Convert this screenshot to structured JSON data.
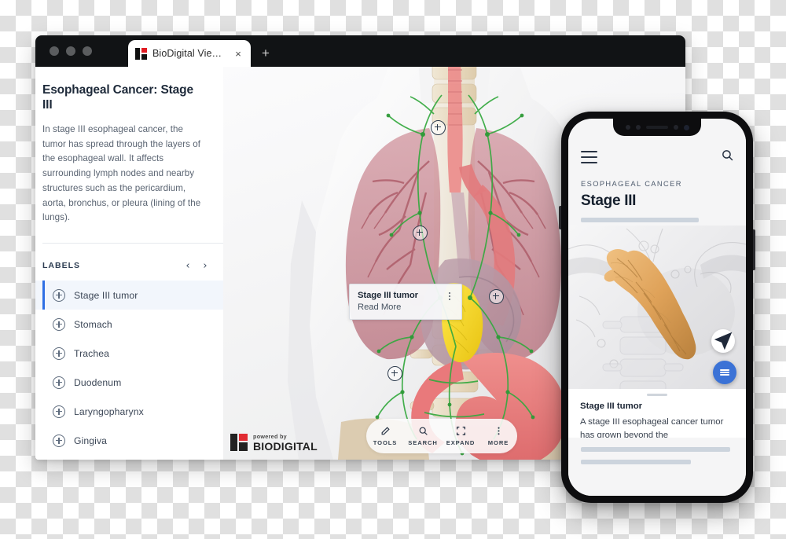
{
  "browser": {
    "tab": {
      "title": "BioDigital Viewer",
      "close_label": "×",
      "favicon": "biodigital-logo-icon"
    },
    "new_tab_label": "+",
    "traffic_lights": 3
  },
  "sidebar": {
    "title": "Esophageal Cancer: Stage III",
    "description": "In stage III esophageal cancer, the tumor has spread through the layers of the esophageal wall. It affects surrounding lymph nodes and nearby structures such as the pericardium, aorta, bronchus, or pleura (lining of the lungs).",
    "labels_header": "LABELS",
    "prev_label": "‹",
    "next_label": "›",
    "items": [
      {
        "label": "Stage III tumor",
        "selected": true
      },
      {
        "label": "Stomach",
        "selected": false
      },
      {
        "label": "Trachea",
        "selected": false
      },
      {
        "label": "Duodenum",
        "selected": false
      },
      {
        "label": "Laryngopharynx",
        "selected": false
      },
      {
        "label": "Gingiva",
        "selected": false
      }
    ]
  },
  "viewer": {
    "tooltip": {
      "title": "Stage III tumor",
      "action": "Read More",
      "menu": "kebab-menu-icon"
    },
    "toolbar": [
      {
        "label": "TOOLS",
        "icon": "pencil-icon"
      },
      {
        "label": "SEARCH",
        "icon": "search-icon"
      },
      {
        "label": "EXPAND",
        "icon": "expand-icon"
      },
      {
        "label": "MORE",
        "icon": "kebab-menu-icon"
      }
    ],
    "watermark": {
      "powered_by": "powered by",
      "brand": "BIODIGITAL"
    },
    "pins": 4
  },
  "phone": {
    "menu_icon": "hamburger-menu-icon",
    "search_icon": "search-icon",
    "eyebrow": "ESOPHAGEAL CANCER",
    "title": "Stage III",
    "card": {
      "title": "Stage III tumor",
      "body": "A stage III esophageal cancer tumor has grown beyond the"
    },
    "locate_icon": "navigation-arrow-icon",
    "fab_icon": "list-menu-icon"
  },
  "colors": {
    "accent_blue": "#3b72d6",
    "selection_blue": "#2f6fe4",
    "brand_red": "#e01b22",
    "tumor_yellow": "#f2d21a",
    "tumor_tan": "#d79a4e",
    "lymph_green": "#3faa46",
    "organ_pink": "#e8767a",
    "bone_tan": "#e4d6bb"
  }
}
